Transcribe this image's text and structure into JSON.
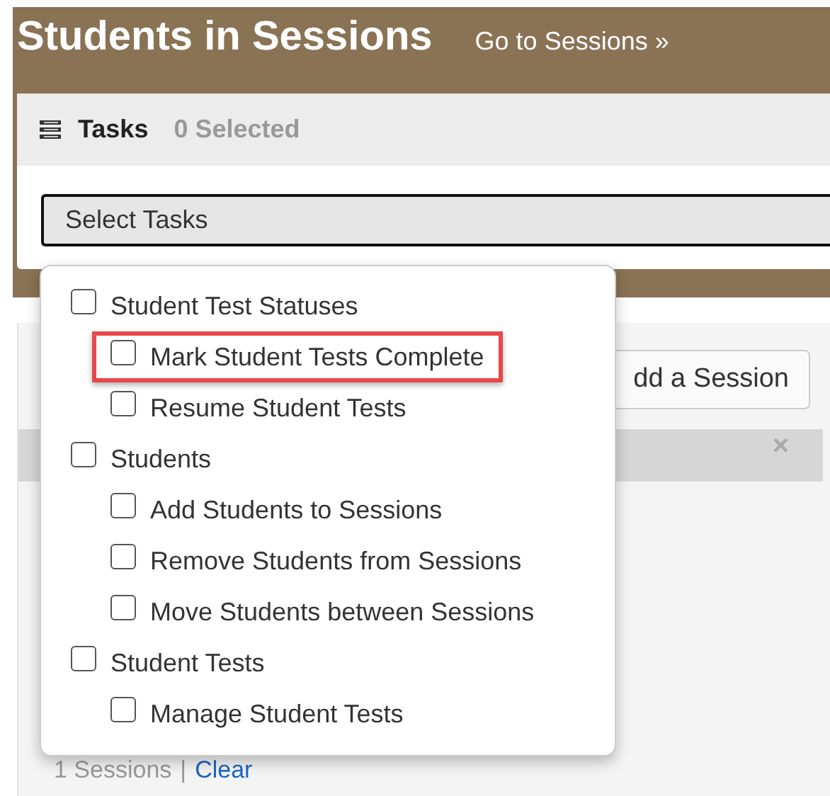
{
  "header": {
    "title": "Students in Sessions",
    "link": "Go to Sessions »"
  },
  "tasks_panel": {
    "title": "Tasks",
    "count": "0 Selected",
    "select": {
      "value": "Select Tasks"
    }
  },
  "task_menu": [
    {
      "label": "Student Test Statuses",
      "checked": false,
      "highlighted": false,
      "children": [
        {
          "label": "Mark Student Tests Complete",
          "checked": false,
          "highlighted": true
        },
        {
          "label": "Resume Student Tests",
          "checked": false,
          "highlighted": false
        }
      ]
    },
    {
      "label": "Students",
      "checked": false,
      "highlighted": false,
      "children": [
        {
          "label": "Add Students to Sessions",
          "checked": false,
          "highlighted": false
        },
        {
          "label": "Remove Students from Sessions",
          "checked": false,
          "highlighted": false
        },
        {
          "label": "Move Students between Sessions",
          "checked": false,
          "highlighted": false
        }
      ]
    },
    {
      "label": "Student Tests",
      "checked": false,
      "highlighted": false,
      "children": [
        {
          "label": "Manage Student Tests",
          "checked": false,
          "highlighted": false
        }
      ]
    }
  ],
  "sessions": {
    "add_button": "dd a Session",
    "close": "×",
    "count": "1 Sessions",
    "separator": "|",
    "clear_link": "Clear"
  }
}
